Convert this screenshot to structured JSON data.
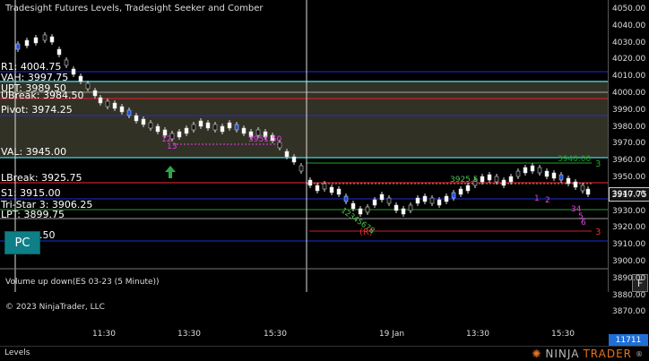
{
  "chart_title": "Tradesight Futures Levels, Tradesight Seeker and Comber",
  "price_axis": {
    "ticks": [
      "4050.00",
      "4040.00",
      "4030.00",
      "4020.00",
      "4010.00",
      "4000.00",
      "3990.00",
      "3980.00",
      "3970.00",
      "3960.00",
      "3950.00",
      "3940.00",
      "3930.00",
      "3920.00",
      "3910.00",
      "3900.00",
      "3890.00",
      "3880.00",
      "3870.00"
    ],
    "current_price": "3917.75",
    "volume_value": "11711"
  },
  "levels": {
    "r1": "R1: 4004.75",
    "vah": "VAH: 3997.75",
    "upt": "UPT: 3989.50",
    "ubreak": "UBreak: 3984.50",
    "pivot": "Pivot: 3974.25",
    "val": "VAL: 3945.00",
    "lbreak": "LBreak: 3925.75",
    "s1": "S1: 3915.00",
    "tristar": "Tri-Star 3: 3906.25",
    "lpt": "LPT: 3899.75",
    "s2_partial": "4.50"
  },
  "annotations": {
    "marker_3951": "3951.50",
    "marker_3925": "3925.5",
    "marker_3940": "3940.00",
    "r_label": "(R)",
    "num_3_a": "3",
    "num_3_b": "3",
    "seq_a": "12345678",
    "seq_b": "12",
    "seq_c": "13",
    "seq_d": "1",
    "seq_e": "2",
    "seq_f": "34",
    "seq_g": "5",
    "seq_h": "6"
  },
  "buttons": {
    "pc": "PC",
    "f": "F"
  },
  "indicator_panel": {
    "label": "Volume up down(ES 03-23 (5 Minute))"
  },
  "copyright": "© 2023 NinjaTrader, LLC",
  "time_axis": [
    "11:30",
    "13:30",
    "15:30",
    "19 Jan",
    "13:30",
    "15:30"
  ],
  "footer": {
    "levels_tab": "Levels",
    "brand_main": "NINJA",
    "brand_accent": "TRADER",
    "brand_reg": "®"
  },
  "colors": {
    "val_band": "#3a3a2a",
    "blue_line": "#1a2fd6",
    "cyan_line": "#40d8e0",
    "red_line": "#c0202a",
    "green_line": "#1fa52a",
    "magenta": "#e53fe5",
    "accent_teal": "#0e7f86"
  }
}
